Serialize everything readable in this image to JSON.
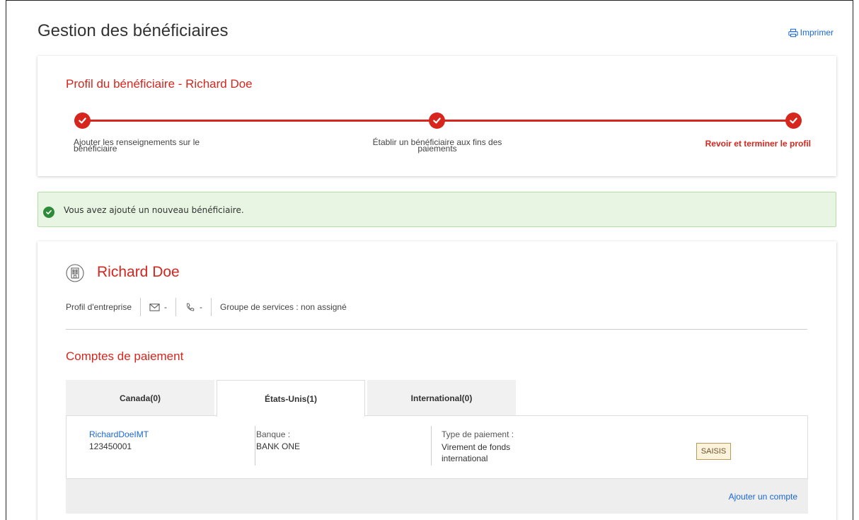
{
  "header": {
    "title": "Gestion des bénéficiaires",
    "print_label": "Imprimer"
  },
  "stepper": {
    "title": "Profil du bénéficiaire - Richard Doe",
    "steps": [
      {
        "label_line1": "Ajouter les renseignements sur le",
        "label_line2": "bénéficiaire"
      },
      {
        "label_line1": "Établir un bénéficiaire aux fins des",
        "label_line2": "paiements"
      },
      {
        "label_line1": "Revoir et terminer le profil",
        "label_line2": ""
      }
    ]
  },
  "banner": {
    "message": "Vous avez ajouté un nouveau bénéficiaire."
  },
  "beneficiary": {
    "name": "Richard Doe",
    "profile_type": "Profil d'entreprise",
    "email": "-",
    "phone": "-",
    "service_group": "Groupe de services : non assigné"
  },
  "accounts": {
    "section_title": "Comptes de paiement",
    "tabs": [
      {
        "label": "Canada(0)"
      },
      {
        "label": "États-Unis(1)"
      },
      {
        "label": "International(0)"
      }
    ],
    "active_tab": 1,
    "items": [
      {
        "name": "RichardDoeIMT",
        "number": "123450001",
        "bank_label": "Banque :",
        "bank_value": "BANK ONE",
        "type_label": "Type de paiement :",
        "type_value": "Virement de fonds international",
        "status": "SAISIS"
      }
    ],
    "add_label": "Ajouter un compte"
  },
  "colors": {
    "accent": "#d7261e",
    "link": "#1a66d6",
    "success_bg": "#e8f5e2",
    "success_icon": "#2e8b3a"
  }
}
